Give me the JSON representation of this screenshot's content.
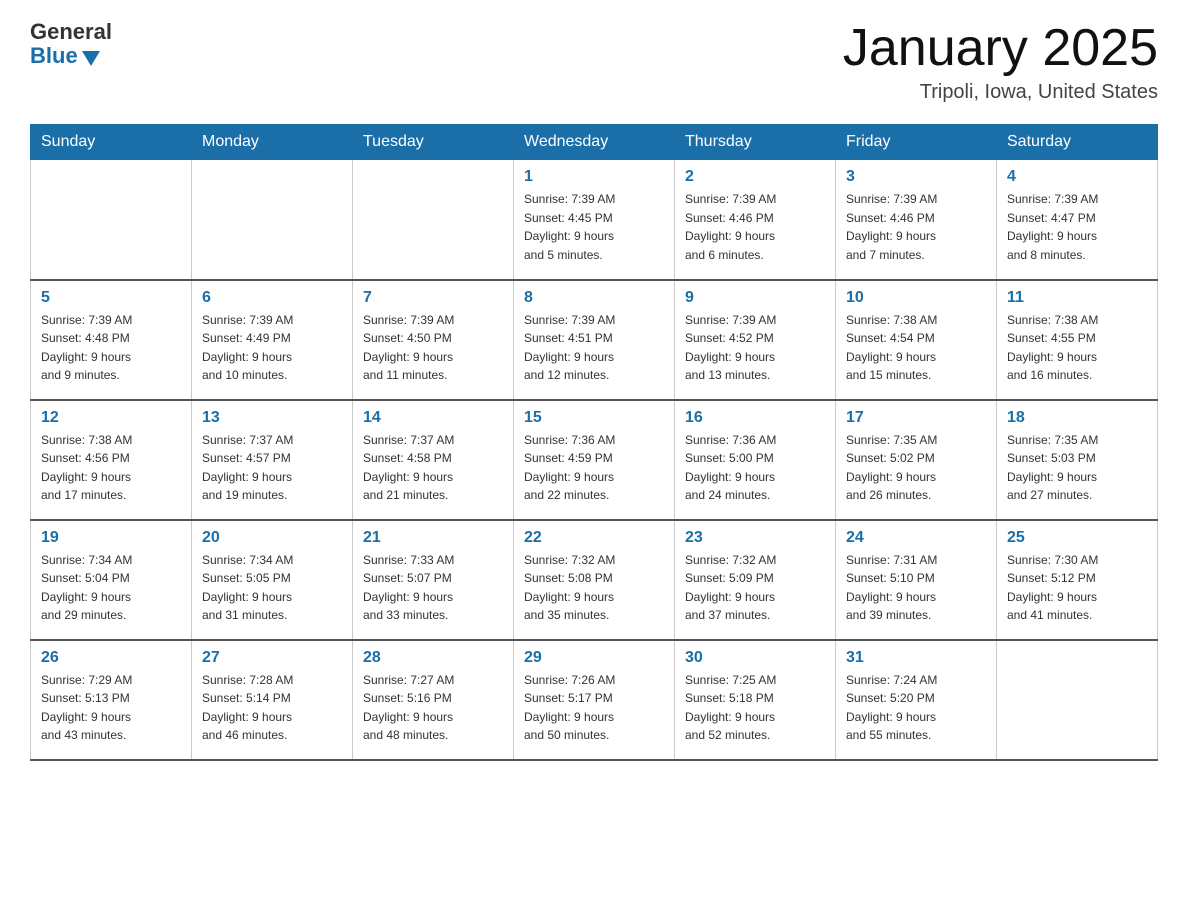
{
  "logo": {
    "general": "General",
    "blue": "Blue"
  },
  "header": {
    "title": "January 2025",
    "location": "Tripoli, Iowa, United States"
  },
  "days_of_week": [
    "Sunday",
    "Monday",
    "Tuesday",
    "Wednesday",
    "Thursday",
    "Friday",
    "Saturday"
  ],
  "weeks": [
    [
      {
        "day": "",
        "info": ""
      },
      {
        "day": "",
        "info": ""
      },
      {
        "day": "",
        "info": ""
      },
      {
        "day": "1",
        "info": "Sunrise: 7:39 AM\nSunset: 4:45 PM\nDaylight: 9 hours\nand 5 minutes."
      },
      {
        "day": "2",
        "info": "Sunrise: 7:39 AM\nSunset: 4:46 PM\nDaylight: 9 hours\nand 6 minutes."
      },
      {
        "day": "3",
        "info": "Sunrise: 7:39 AM\nSunset: 4:46 PM\nDaylight: 9 hours\nand 7 minutes."
      },
      {
        "day": "4",
        "info": "Sunrise: 7:39 AM\nSunset: 4:47 PM\nDaylight: 9 hours\nand 8 minutes."
      }
    ],
    [
      {
        "day": "5",
        "info": "Sunrise: 7:39 AM\nSunset: 4:48 PM\nDaylight: 9 hours\nand 9 minutes."
      },
      {
        "day": "6",
        "info": "Sunrise: 7:39 AM\nSunset: 4:49 PM\nDaylight: 9 hours\nand 10 minutes."
      },
      {
        "day": "7",
        "info": "Sunrise: 7:39 AM\nSunset: 4:50 PM\nDaylight: 9 hours\nand 11 minutes."
      },
      {
        "day": "8",
        "info": "Sunrise: 7:39 AM\nSunset: 4:51 PM\nDaylight: 9 hours\nand 12 minutes."
      },
      {
        "day": "9",
        "info": "Sunrise: 7:39 AM\nSunset: 4:52 PM\nDaylight: 9 hours\nand 13 minutes."
      },
      {
        "day": "10",
        "info": "Sunrise: 7:38 AM\nSunset: 4:54 PM\nDaylight: 9 hours\nand 15 minutes."
      },
      {
        "day": "11",
        "info": "Sunrise: 7:38 AM\nSunset: 4:55 PM\nDaylight: 9 hours\nand 16 minutes."
      }
    ],
    [
      {
        "day": "12",
        "info": "Sunrise: 7:38 AM\nSunset: 4:56 PM\nDaylight: 9 hours\nand 17 minutes."
      },
      {
        "day": "13",
        "info": "Sunrise: 7:37 AM\nSunset: 4:57 PM\nDaylight: 9 hours\nand 19 minutes."
      },
      {
        "day": "14",
        "info": "Sunrise: 7:37 AM\nSunset: 4:58 PM\nDaylight: 9 hours\nand 21 minutes."
      },
      {
        "day": "15",
        "info": "Sunrise: 7:36 AM\nSunset: 4:59 PM\nDaylight: 9 hours\nand 22 minutes."
      },
      {
        "day": "16",
        "info": "Sunrise: 7:36 AM\nSunset: 5:00 PM\nDaylight: 9 hours\nand 24 minutes."
      },
      {
        "day": "17",
        "info": "Sunrise: 7:35 AM\nSunset: 5:02 PM\nDaylight: 9 hours\nand 26 minutes."
      },
      {
        "day": "18",
        "info": "Sunrise: 7:35 AM\nSunset: 5:03 PM\nDaylight: 9 hours\nand 27 minutes."
      }
    ],
    [
      {
        "day": "19",
        "info": "Sunrise: 7:34 AM\nSunset: 5:04 PM\nDaylight: 9 hours\nand 29 minutes."
      },
      {
        "day": "20",
        "info": "Sunrise: 7:34 AM\nSunset: 5:05 PM\nDaylight: 9 hours\nand 31 minutes."
      },
      {
        "day": "21",
        "info": "Sunrise: 7:33 AM\nSunset: 5:07 PM\nDaylight: 9 hours\nand 33 minutes."
      },
      {
        "day": "22",
        "info": "Sunrise: 7:32 AM\nSunset: 5:08 PM\nDaylight: 9 hours\nand 35 minutes."
      },
      {
        "day": "23",
        "info": "Sunrise: 7:32 AM\nSunset: 5:09 PM\nDaylight: 9 hours\nand 37 minutes."
      },
      {
        "day": "24",
        "info": "Sunrise: 7:31 AM\nSunset: 5:10 PM\nDaylight: 9 hours\nand 39 minutes."
      },
      {
        "day": "25",
        "info": "Sunrise: 7:30 AM\nSunset: 5:12 PM\nDaylight: 9 hours\nand 41 minutes."
      }
    ],
    [
      {
        "day": "26",
        "info": "Sunrise: 7:29 AM\nSunset: 5:13 PM\nDaylight: 9 hours\nand 43 minutes."
      },
      {
        "day": "27",
        "info": "Sunrise: 7:28 AM\nSunset: 5:14 PM\nDaylight: 9 hours\nand 46 minutes."
      },
      {
        "day": "28",
        "info": "Sunrise: 7:27 AM\nSunset: 5:16 PM\nDaylight: 9 hours\nand 48 minutes."
      },
      {
        "day": "29",
        "info": "Sunrise: 7:26 AM\nSunset: 5:17 PM\nDaylight: 9 hours\nand 50 minutes."
      },
      {
        "day": "30",
        "info": "Sunrise: 7:25 AM\nSunset: 5:18 PM\nDaylight: 9 hours\nand 52 minutes."
      },
      {
        "day": "31",
        "info": "Sunrise: 7:24 AM\nSunset: 5:20 PM\nDaylight: 9 hours\nand 55 minutes."
      },
      {
        "day": "",
        "info": ""
      }
    ]
  ]
}
